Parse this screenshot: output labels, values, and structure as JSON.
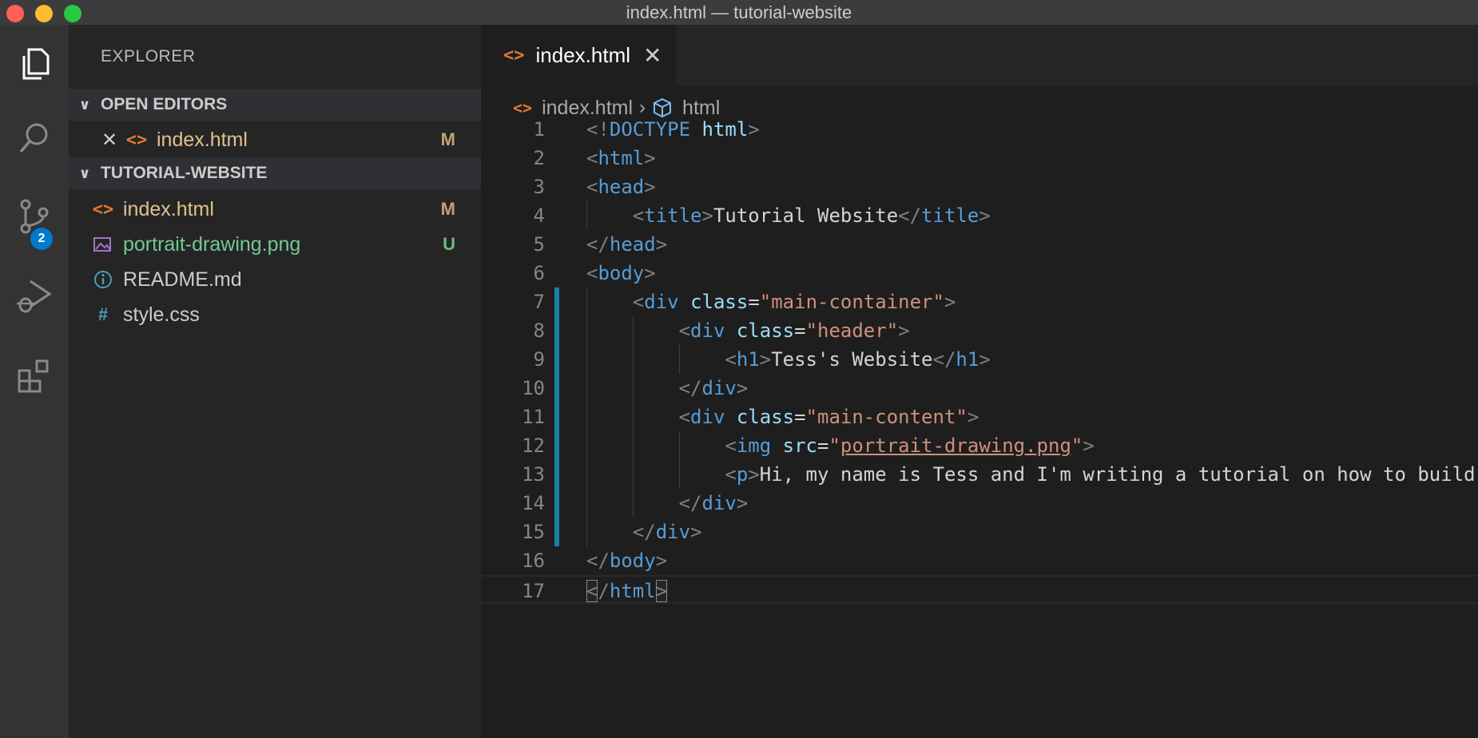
{
  "window": {
    "title": "index.html — tutorial-website"
  },
  "sidebar": {
    "title": "EXPLORER",
    "open_editors": {
      "label": "OPEN EDITORS",
      "items": [
        {
          "name": "index.html",
          "status": "M"
        }
      ]
    },
    "project": {
      "label": "TUTORIAL-WEBSITE",
      "files": [
        {
          "name": "index.html",
          "status": "M",
          "icon": "html-icon"
        },
        {
          "name": "portrait-drawing.png",
          "status": "U",
          "icon": "image-icon"
        },
        {
          "name": "README.md",
          "status": "",
          "icon": "info-icon"
        },
        {
          "name": "style.css",
          "status": "",
          "icon": "hash-icon"
        }
      ]
    }
  },
  "activity_bar": {
    "scm_badge": "2"
  },
  "editor": {
    "tab": {
      "label": "index.html"
    },
    "breadcrumb": {
      "file": "index.html",
      "symbol": "html"
    },
    "lines": [
      {
        "n": "1",
        "tokens": [
          [
            "p",
            "<!"
          ],
          [
            "t",
            "DOCTYPE"
          ],
          [
            "x",
            " "
          ],
          [
            "a",
            "html"
          ],
          [
            "p",
            ">"
          ]
        ]
      },
      {
        "n": "2",
        "tokens": [
          [
            "p",
            "<"
          ],
          [
            "t",
            "html"
          ],
          [
            "p",
            ">"
          ]
        ]
      },
      {
        "n": "3",
        "tokens": [
          [
            "p",
            "<"
          ],
          [
            "t",
            "head"
          ],
          [
            "p",
            ">"
          ]
        ]
      },
      {
        "n": "4",
        "tokens": [
          [
            "x",
            "    "
          ],
          [
            "p",
            "<"
          ],
          [
            "t",
            "title"
          ],
          [
            "p",
            ">"
          ],
          [
            "x",
            "Tutorial Website"
          ],
          [
            "p",
            "</"
          ],
          [
            "t",
            "title"
          ],
          [
            "p",
            ">"
          ]
        ]
      },
      {
        "n": "5",
        "tokens": [
          [
            "p",
            "</"
          ],
          [
            "t",
            "head"
          ],
          [
            "p",
            ">"
          ]
        ]
      },
      {
        "n": "6",
        "tokens": [
          [
            "p",
            "<"
          ],
          [
            "t",
            "body"
          ],
          [
            "p",
            ">"
          ]
        ]
      },
      {
        "n": "7",
        "tokens": [
          [
            "x",
            "    "
          ],
          [
            "p",
            "<"
          ],
          [
            "t",
            "div"
          ],
          [
            "x",
            " "
          ],
          [
            "a",
            "class"
          ],
          [
            "x",
            "="
          ],
          [
            "s",
            "\"main-container\""
          ],
          [
            "p",
            ">"
          ]
        ]
      },
      {
        "n": "8",
        "tokens": [
          [
            "x",
            "        "
          ],
          [
            "p",
            "<"
          ],
          [
            "t",
            "div"
          ],
          [
            "x",
            " "
          ],
          [
            "a",
            "class"
          ],
          [
            "x",
            "="
          ],
          [
            "s",
            "\"header\""
          ],
          [
            "p",
            ">"
          ]
        ]
      },
      {
        "n": "9",
        "tokens": [
          [
            "x",
            "            "
          ],
          [
            "p",
            "<"
          ],
          [
            "t",
            "h1"
          ],
          [
            "p",
            ">"
          ],
          [
            "x",
            "Tess's Website"
          ],
          [
            "p",
            "</"
          ],
          [
            "t",
            "h1"
          ],
          [
            "p",
            ">"
          ]
        ]
      },
      {
        "n": "10",
        "tokens": [
          [
            "x",
            "        "
          ],
          [
            "p",
            "</"
          ],
          [
            "t",
            "div"
          ],
          [
            "p",
            ">"
          ]
        ]
      },
      {
        "n": "11",
        "tokens": [
          [
            "x",
            "        "
          ],
          [
            "p",
            "<"
          ],
          [
            "t",
            "div"
          ],
          [
            "x",
            " "
          ],
          [
            "a",
            "class"
          ],
          [
            "x",
            "="
          ],
          [
            "s",
            "\"main-content\""
          ],
          [
            "p",
            ">"
          ]
        ]
      },
      {
        "n": "12",
        "tokens": [
          [
            "x",
            "            "
          ],
          [
            "p",
            "<"
          ],
          [
            "t",
            "img"
          ],
          [
            "x",
            " "
          ],
          [
            "a",
            "src"
          ],
          [
            "x",
            "="
          ],
          [
            "s",
            "\""
          ],
          [
            "sl",
            "portrait-drawing.png"
          ],
          [
            "s",
            "\""
          ],
          [
            "p",
            ">"
          ]
        ]
      },
      {
        "n": "13",
        "tokens": [
          [
            "x",
            "            "
          ],
          [
            "p",
            "<"
          ],
          [
            "t",
            "p"
          ],
          [
            "p",
            ">"
          ],
          [
            "x",
            "Hi, my name is Tess and I'm writing a tutorial on how to build"
          ]
        ]
      },
      {
        "n": "14",
        "tokens": [
          [
            "x",
            "        "
          ],
          [
            "p",
            "</"
          ],
          [
            "t",
            "div"
          ],
          [
            "p",
            ">"
          ]
        ]
      },
      {
        "n": "15",
        "tokens": [
          [
            "x",
            "    "
          ],
          [
            "p",
            "</"
          ],
          [
            "t",
            "div"
          ],
          [
            "p",
            ">"
          ]
        ]
      },
      {
        "n": "16",
        "tokens": [
          [
            "p",
            "</"
          ],
          [
            "t",
            "body"
          ],
          [
            "p",
            ">"
          ]
        ]
      },
      {
        "n": "17",
        "tokens": [
          [
            "bh",
            "<"
          ],
          [
            "p",
            "/"
          ],
          [
            "t",
            "html"
          ],
          [
            "bh",
            ">"
          ]
        ]
      }
    ]
  },
  "colors": {
    "accent": "#007acc",
    "modified": "#e2c08d",
    "untracked": "#73c991",
    "tag": "#569cd6",
    "attribute": "#9cdcfe",
    "string": "#ce9178"
  }
}
